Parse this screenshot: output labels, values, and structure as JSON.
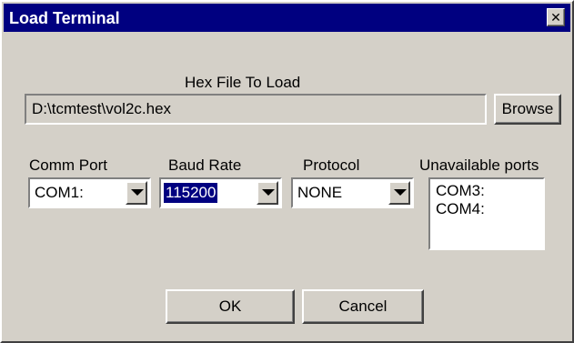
{
  "window": {
    "title": "Load Terminal",
    "close_glyph": "✕"
  },
  "hex_file": {
    "label": "Hex File To Load",
    "value": "D:\\tcmtest\\vol2c.hex",
    "browse_label": "Browse"
  },
  "comm_port": {
    "label": "Comm Port",
    "selected": "COM1:"
  },
  "baud_rate": {
    "label": "Baud Rate",
    "selected": "115200"
  },
  "protocol": {
    "label": "Protocol",
    "selected": "NONE"
  },
  "unavailable_ports": {
    "label": "Unavailable ports",
    "items": [
      "COM3:",
      "COM4:"
    ]
  },
  "buttons": {
    "ok_label": "OK",
    "cancel_label": "Cancel"
  },
  "colors": {
    "titlebar": "#000080",
    "face": "#d4d0c8",
    "selection": "#000080"
  }
}
